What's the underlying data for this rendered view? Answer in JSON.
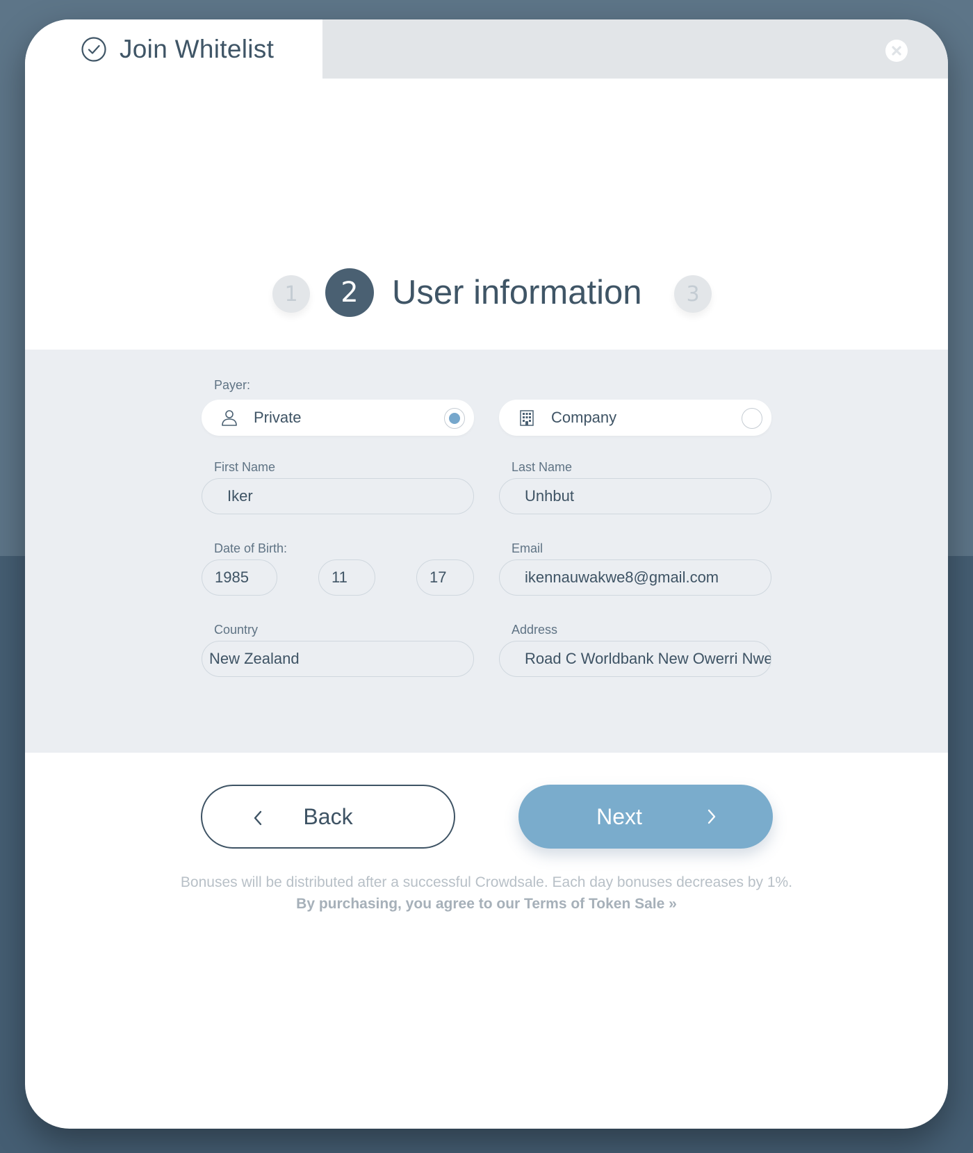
{
  "header": {
    "title": "Join Whitelist"
  },
  "steps": {
    "step1": "1",
    "step2": "2",
    "step2_title": "User information",
    "step3": "3"
  },
  "form": {
    "payer_label": "Payer:",
    "payer_options": [
      {
        "label": "Private",
        "icon": "user-icon",
        "selected": true
      },
      {
        "label": "Company",
        "icon": "building-icon",
        "selected": false
      }
    ],
    "first_name": {
      "label": "First Name",
      "value": "Iker"
    },
    "last_name": {
      "label": "Last Name",
      "value": "Unhbut"
    },
    "dob": {
      "label": "Date of Birth:",
      "year": "1985",
      "month": "11",
      "day": "17"
    },
    "email": {
      "label": "Email",
      "value": "ikennauwakwe8@gmail.com"
    },
    "country": {
      "label": "Country",
      "value": "New Zealand"
    },
    "address": {
      "label": "Address",
      "value": "Road C Worldbank New Owerri Nwe"
    }
  },
  "buttons": {
    "back": "Back",
    "next": "Next"
  },
  "footer": {
    "note": "Bonuses will be distributed after a successful Crowdsale. Each day bonuses decreases by 1%.",
    "terms": "By purchasing, you agree to our Terms of Token Sale »"
  },
  "colors": {
    "accent": "#7aaccc",
    "dark": "#4a6072",
    "form_bg": "#ebeef2"
  }
}
